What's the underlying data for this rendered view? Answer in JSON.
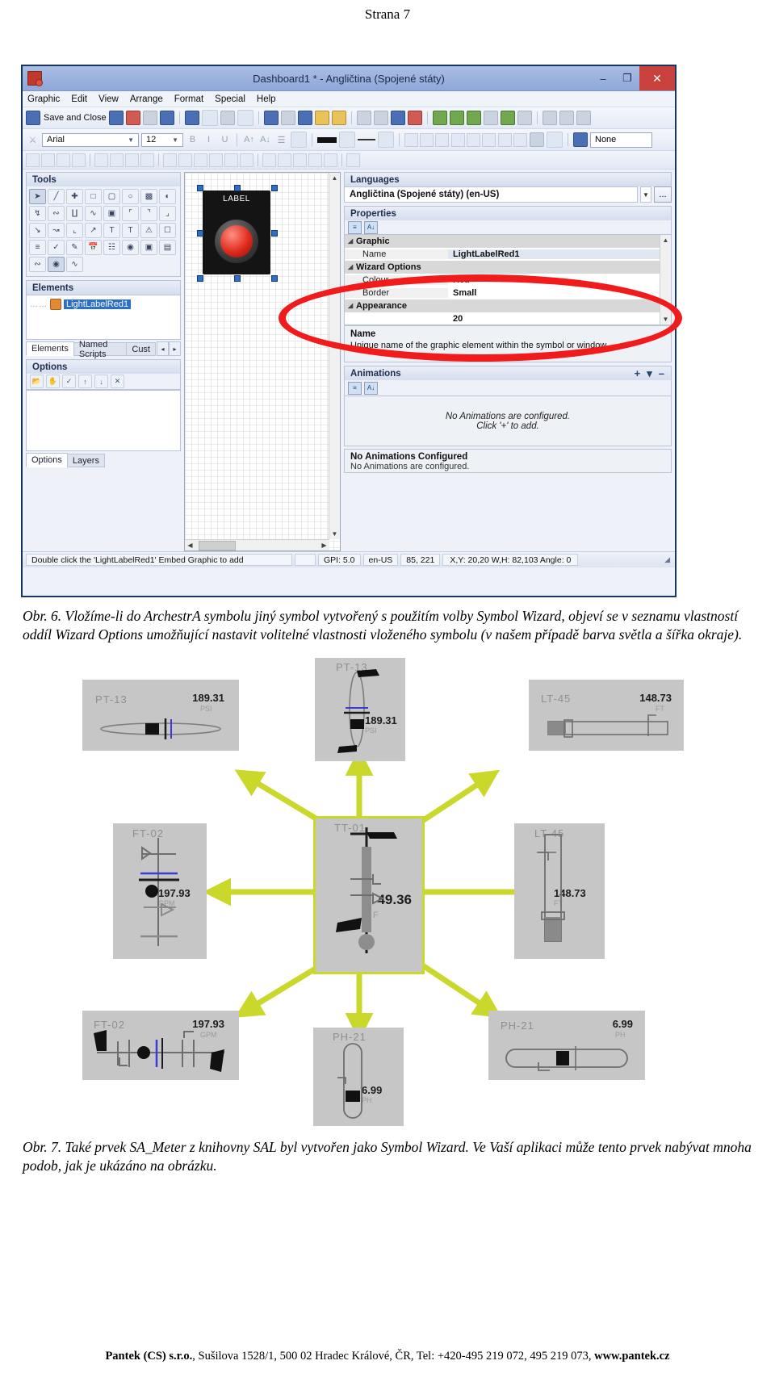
{
  "page": {
    "header": "Strana 7"
  },
  "app": {
    "title": "Dashboard1 * - Angličtina (Spojené státy)",
    "window_buttons": {
      "minimize": "–",
      "maximize": "❐",
      "close": "✕"
    },
    "menu": [
      "Graphic",
      "Edit",
      "View",
      "Arrange",
      "Format",
      "Special",
      "Help"
    ],
    "toolbar": {
      "save_and_close": "Save and Close"
    },
    "fontbar": {
      "font": "Arial",
      "size": "12",
      "bold": "B",
      "italic": "I",
      "underline": "U",
      "line_style": "None"
    },
    "tools_panel": {
      "title": "Tools"
    },
    "elements_panel": {
      "title": "Elements",
      "item": "LightLabelRed1",
      "tabs": [
        "Elements",
        "Named Scripts",
        "Cust"
      ],
      "tab_prev": "◂",
      "tab_next": "▸"
    },
    "options_panel": {
      "title": "Options",
      "tabs": [
        "Options",
        "Layers"
      ]
    },
    "canvas": {
      "label": "LABEL"
    },
    "languages_panel": {
      "title": "Languages",
      "selected": "Angličtina (Spojené státy) (en-US)",
      "browse": "..."
    },
    "properties_panel": {
      "title": "Properties",
      "rows": [
        {
          "kind": "category",
          "name": "Graphic",
          "value": ""
        },
        {
          "kind": "prop",
          "name": "Name",
          "value": "LightLabelRed1"
        },
        {
          "kind": "category",
          "name": "Wizard Options",
          "value": ""
        },
        {
          "kind": "prop",
          "name": "Colour",
          "value": "Red"
        },
        {
          "kind": "prop",
          "name": "Border",
          "value": "Small"
        },
        {
          "kind": "category",
          "name": "Appearance",
          "value": ""
        },
        {
          "kind": "prop",
          "name": "",
          "value": "20"
        }
      ],
      "description_title": "Name",
      "description_text": "Unique name of the graphic element within the symbol or window."
    },
    "animations_panel": {
      "title": "Animations",
      "add": "+",
      "remove": "–",
      "empty_line1": "No Animations are configured.",
      "empty_line2": "Click '+' to add.",
      "footer_title": "No Animations Configured",
      "footer_sub": "No Animations are configured."
    },
    "statusbar": {
      "hint": "Double click the 'LightLabelRed1' Embed Graphic to add",
      "blank": "",
      "gpi": "GPI: 5.0",
      "locale": "en-US",
      "mouse": "85, 221",
      "geometry": "X,Y: 20,20   W,H: 82,103   Angle: 0"
    }
  },
  "captions": {
    "fig6": "Obr. 6. Vložíme-li do ArchestrA symbolu jiný symbol vytvořený s použitím volby Symbol Wizard, objeví se v seznamu vlastností oddíl Wizard Options umožňující nastavit volitelné vlastnosti vloženého symbolu (v našem případě barva světla a šířka okraje).",
    "fig7": "Obr. 7. Také prvek SA_Meter z knihovny SAL byl vytvořen jako Symbol Wizard. Ve Vaší aplikaci může tento prvek nabývat mnoha podob, jak je ukázáno na obrázku."
  },
  "diagram": {
    "center": {
      "tag": "TT-01",
      "value": "49.36",
      "unit": "F"
    },
    "meters": [
      {
        "id": "pt13-vertical",
        "tag": "PT-13",
        "value": "189.31",
        "unit": "PSI"
      },
      {
        "id": "pt13-horizontal",
        "tag": "PT-13",
        "value": "189.31",
        "unit": "PSI"
      },
      {
        "id": "lt45-horizontal",
        "tag": "LT-45",
        "value": "148.73",
        "unit": "FT"
      },
      {
        "id": "lt45-vertical",
        "tag": "LT-45",
        "value": "148.73",
        "unit": "FT"
      },
      {
        "id": "ft02-vertical",
        "tag": "FT-02",
        "value": "197.93",
        "unit": "GPM"
      },
      {
        "id": "ft02-horizontal",
        "tag": "FT-02",
        "value": "197.93",
        "unit": "GPM"
      },
      {
        "id": "ph21-vertical",
        "tag": "PH-21",
        "value": "6.99",
        "unit": "PH"
      },
      {
        "id": "ph21-horizontal",
        "tag": "PH-21",
        "value": "6.99",
        "unit": "PH"
      }
    ],
    "accent_color": "#c9d82b",
    "box_color": "#c6c6c6"
  },
  "footer": {
    "company": "Pantek (CS) s.r.o.",
    "rest": ", Sušilova 1528/1, 500 02 Hradec Králové, ČR, Tel: +420-495 219 072, 495 219 073, ",
    "web": "www.pantek.cz"
  }
}
